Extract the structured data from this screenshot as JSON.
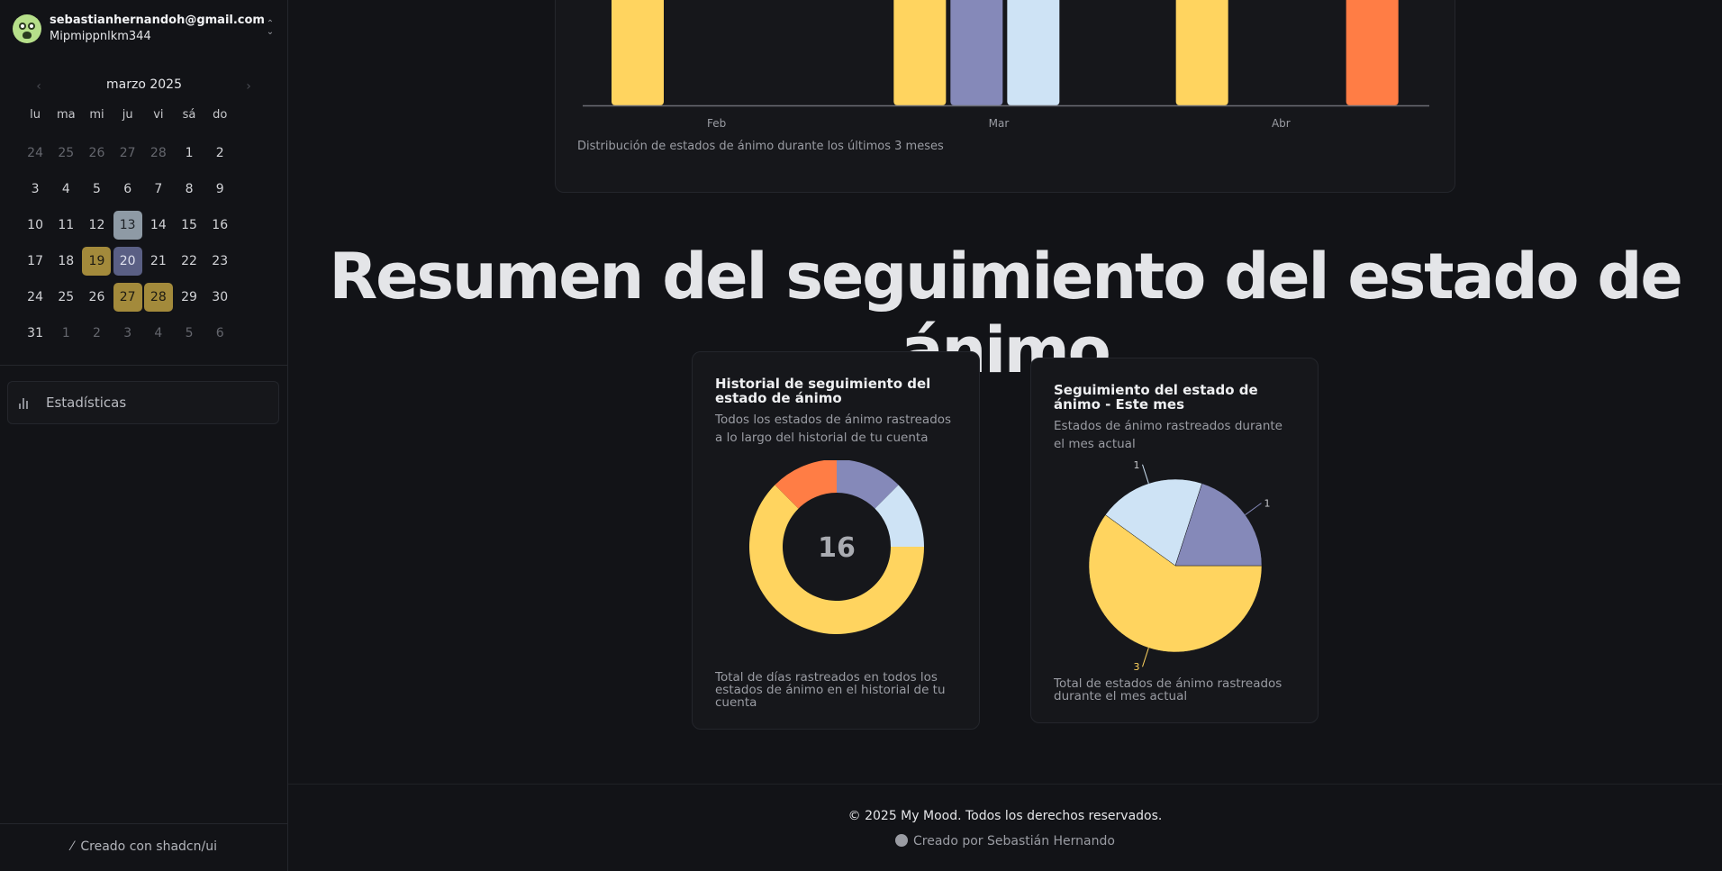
{
  "user": {
    "email": "sebastianhernandoh@gmail.com",
    "name": "Mipmippnlkm344"
  },
  "calendar": {
    "title": "marzo 2025",
    "weekdays": [
      "lu",
      "ma",
      "mi",
      "ju",
      "vi",
      "sá",
      "do"
    ],
    "weeks": [
      [
        "24",
        "25",
        "26",
        "27",
        "28",
        "1",
        "2"
      ],
      [
        "3",
        "4",
        "5",
        "6",
        "7",
        "8",
        "9"
      ],
      [
        "10",
        "11",
        "12",
        "13",
        "14",
        "15",
        "16"
      ],
      [
        "17",
        "18",
        "19",
        "20",
        "21",
        "22",
        "23"
      ],
      [
        "24",
        "25",
        "26",
        "27",
        "28",
        "29",
        "30"
      ],
      [
        "31",
        "1",
        "2",
        "3",
        "4",
        "5",
        "6"
      ]
    ],
    "highlighted": {
      "13": "gray",
      "19": "yellow",
      "20": "purple",
      "27": "yellow",
      "28": "yellow"
    }
  },
  "sidebar": {
    "nav_stats": "Estadísticas",
    "footer": "Creado con shadcn/ui"
  },
  "bar_card": {
    "caption": "Distribución de estados de ánimo durante los últimos 3 meses"
  },
  "main_title": "Resumen del seguimiento del estado de ánimo",
  "history_card": {
    "title": "Historial de seguimiento del estado de ánimo",
    "description": "Todos los estados de ánimo rastreados a lo largo del historial de tu cuenta",
    "total": "16",
    "footer": "Total de días rastreados en todos los estados de ánimo en el historial de tu cuenta"
  },
  "month_card": {
    "title": "Seguimiento del estado de ánimo - Este mes",
    "description": "Estados de ánimo rastreados durante el mes actual",
    "footer": "Total de estados de ánimo rastreados durante el mes actual"
  },
  "footer": {
    "copyright": "© 2025 My Mood. Todos los derechos reservados.",
    "credit": "Creado por Sebastián Hernando"
  },
  "colors": {
    "yellow": "#ffd45f",
    "purple": "#8589b9",
    "lightblue": "#cee3f5",
    "orange": "#ff7d45"
  },
  "chart_data": [
    {
      "type": "bar",
      "categories": [
        "Feb",
        "Mar",
        "Abr"
      ],
      "series": [
        {
          "color": "#ffd45f",
          "values": [
            null,
            null,
            null
          ]
        },
        {
          "color": "#8589b9",
          "values": [
            null,
            null,
            null
          ]
        },
        {
          "color": "#cee3f5",
          "values": [
            null,
            null,
            null
          ]
        },
        {
          "color": "#ff7d45",
          "values": [
            null,
            null,
            null
          ]
        }
      ],
      "visible_bars": [
        {
          "category": "Feb",
          "color": "#ffd45f"
        },
        {
          "category": "Mar",
          "color": "#ffd45f"
        },
        {
          "category": "Mar",
          "color": "#8589b9"
        },
        {
          "category": "Mar",
          "color": "#cee3f5"
        },
        {
          "category": "Abr",
          "color": "#ffd45f"
        },
        {
          "category": "Abr",
          "color": "#ff7d45"
        }
      ]
    },
    {
      "type": "pie",
      "donut": true,
      "total_label": "16",
      "slices": [
        {
          "color": "#ffd45f",
          "value": 10
        },
        {
          "color": "#ff7d45",
          "value": 2
        },
        {
          "color": "#8589b9",
          "value": 2
        },
        {
          "color": "#cee3f5",
          "value": 2
        }
      ]
    },
    {
      "type": "pie",
      "slices": [
        {
          "color": "#ffd45f",
          "value": 3,
          "label": "3"
        },
        {
          "color": "#cee3f5",
          "value": 1,
          "label": "1"
        },
        {
          "color": "#8589b9",
          "value": 1,
          "label": "1"
        }
      ]
    }
  ]
}
